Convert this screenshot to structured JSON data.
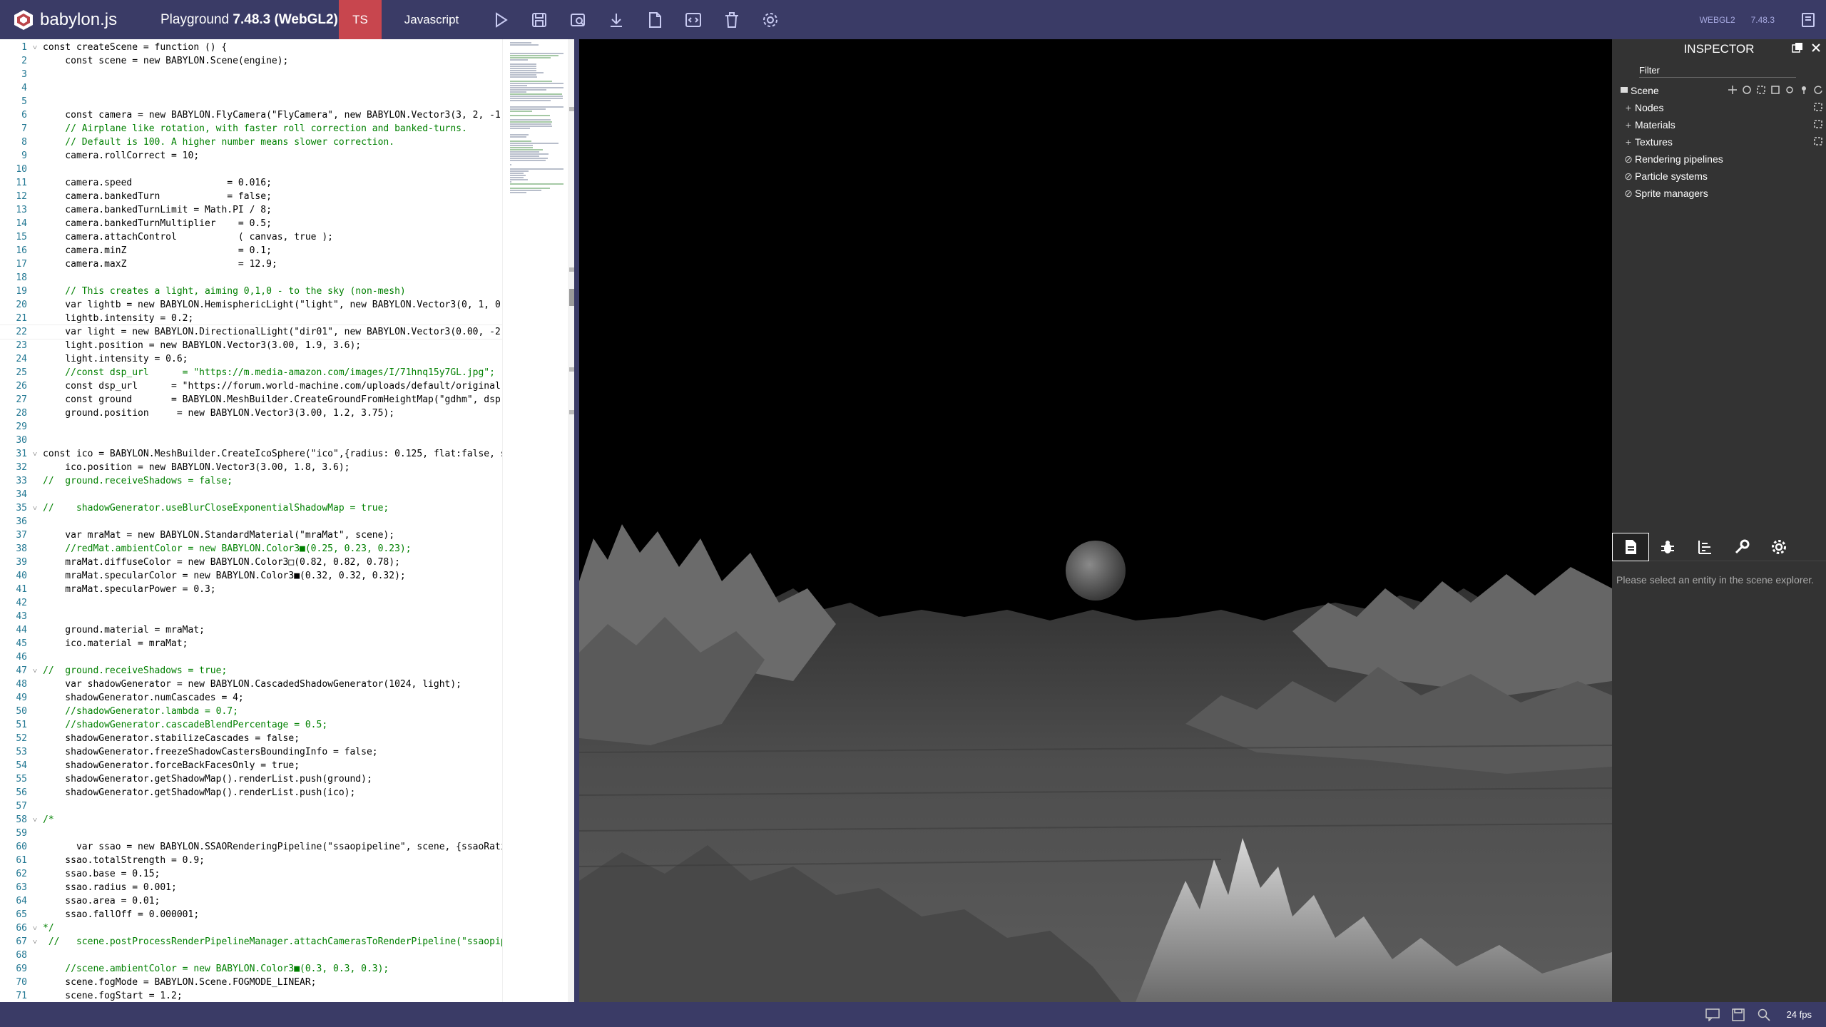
{
  "app": {
    "brand": "babylon.js",
    "title_prefix": "Playground ",
    "title_version": "7.48.3 (WebGL2)",
    "tabs": [
      "TS",
      "Javascript"
    ],
    "engine_label": "WEBGL2",
    "version_label": "7.48.3",
    "accent_color": "#3a3b66",
    "active_tab_color": "#c8464e"
  },
  "toolbar": {
    "icons": [
      "run-icon",
      "save-icon",
      "inspector-download-icon",
      "download-icon",
      "new-file-icon",
      "format-code-icon",
      "clear-icon",
      "settings-icon"
    ]
  },
  "editor": {
    "lines": [
      {
        "n": "1",
        "fold": "v",
        "t": "const createScene = function () {"
      },
      {
        "n": "2",
        "fold": "",
        "t": "    const scene = new BABYLON.Scene(engine);"
      },
      {
        "n": "3",
        "fold": "",
        "t": ""
      },
      {
        "n": "4",
        "fold": "",
        "t": ""
      },
      {
        "n": "5",
        "fold": "",
        "t": ""
      },
      {
        "n": "6",
        "fold": "",
        "t": "    const camera = new BABYLON.FlyCamera(\"FlyCamera\", new BABYLON.Vector3(3, 2, -1)"
      },
      {
        "n": "7",
        "fold": "",
        "t": "    // Airplane like rotation, with faster roll correction and banked-turns."
      },
      {
        "n": "8",
        "fold": "",
        "t": "    // Default is 100. A higher number means slower correction."
      },
      {
        "n": "9",
        "fold": "",
        "t": "    camera.rollCorrect = 10;"
      },
      {
        "n": "10",
        "fold": "",
        "t": ""
      },
      {
        "n": "11",
        "fold": "",
        "t": "    camera.speed                 = 0.016;"
      },
      {
        "n": "12",
        "fold": "",
        "t": "    camera.bankedTurn            = false;"
      },
      {
        "n": "13",
        "fold": "",
        "t": "    camera.bankedTurnLimit = Math.PI / 8;"
      },
      {
        "n": "14",
        "fold": "",
        "t": "    camera.bankedTurnMultiplier    = 0.5;"
      },
      {
        "n": "15",
        "fold": "",
        "t": "    camera.attachControl           ( canvas, true );"
      },
      {
        "n": "16",
        "fold": "",
        "t": "    camera.minZ                    = 0.1;"
      },
      {
        "n": "17",
        "fold": "",
        "t": "    camera.maxZ                    = 12.9;"
      },
      {
        "n": "18",
        "fold": "",
        "t": ""
      },
      {
        "n": "19",
        "fold": "",
        "t": "    // This creates a light, aiming 0,1,0 - to the sky (non-mesh)"
      },
      {
        "n": "20",
        "fold": "",
        "t": "    var lightb = new BABYLON.HemisphericLight(\"light\", new BABYLON.Vector3(0, 1, 0)"
      },
      {
        "n": "21",
        "fold": "",
        "t": "    lightb.intensity = 0.2;"
      },
      {
        "n": "22",
        "fold": "",
        "t": "    var light = new BABYLON.DirectionalLight(\"dir01\", new BABYLON.Vector3(0.00, -2."
      },
      {
        "n": "23",
        "fold": "",
        "t": "    light.position = new BABYLON.Vector3(3.00, 1.9, 3.6);"
      },
      {
        "n": "24",
        "fold": "",
        "t": "    light.intensity = 0.6;"
      },
      {
        "n": "25",
        "fold": "",
        "t": "    //const dsp_url      = \"https://m.media-amazon.com/images/I/71hnq15y7GL.jpg\";"
      },
      {
        "n": "26",
        "fold": "",
        "t": "    const dsp_url      = \"https://forum.world-machine.com/uploads/default/original"
      },
      {
        "n": "27",
        "fold": "",
        "t": "    const ground       = BABYLON.MeshBuilder.CreateGroundFromHeightMap(\"gdhm\", dsp"
      },
      {
        "n": "28",
        "fold": "",
        "t": "    ground.position     = new BABYLON.Vector3(3.00, 1.2, 3.75);"
      },
      {
        "n": "29",
        "fold": "",
        "t": ""
      },
      {
        "n": "30",
        "fold": "",
        "t": ""
      },
      {
        "n": "31",
        "fold": "v",
        "t": "const ico = BABYLON.MeshBuilder.CreateIcoSphere(\"ico\",{radius: 0.125, flat:false, s"
      },
      {
        "n": "32",
        "fold": "",
        "t": "    ico.position = new BABYLON.Vector3(3.00, 1.8, 3.6);"
      },
      {
        "n": "33",
        "fold": "",
        "t": "//  ground.receiveShadows = false;"
      },
      {
        "n": "34",
        "fold": "",
        "t": ""
      },
      {
        "n": "35",
        "fold": "v",
        "t": "//    shadowGenerator.useBlurCloseExponentialShadowMap = true;"
      },
      {
        "n": "36",
        "fold": "",
        "t": ""
      },
      {
        "n": "37",
        "fold": "",
        "t": "    var mraMat = new BABYLON.StandardMaterial(\"mraMat\", scene);"
      },
      {
        "n": "38",
        "fold": "",
        "t": "    //redMat.ambientColor = new BABYLON.Color3■(0.25, 0.23, 0.23);"
      },
      {
        "n": "39",
        "fold": "",
        "t": "    mraMat.diffuseColor = new BABYLON.Color3□(0.82, 0.82, 0.78);"
      },
      {
        "n": "40",
        "fold": "",
        "t": "    mraMat.specularColor = new BABYLON.Color3■(0.32, 0.32, 0.32);"
      },
      {
        "n": "41",
        "fold": "",
        "t": "    mraMat.specularPower = 0.3;"
      },
      {
        "n": "42",
        "fold": "",
        "t": ""
      },
      {
        "n": "43",
        "fold": "",
        "t": ""
      },
      {
        "n": "44",
        "fold": "",
        "t": "    ground.material = mraMat;"
      },
      {
        "n": "45",
        "fold": "",
        "t": "    ico.material = mraMat;"
      },
      {
        "n": "46",
        "fold": "",
        "t": ""
      },
      {
        "n": "47",
        "fold": "v",
        "t": "//  ground.receiveShadows = true;"
      },
      {
        "n": "48",
        "fold": "",
        "t": "    var shadowGenerator = new BABYLON.CascadedShadowGenerator(1024, light);"
      },
      {
        "n": "49",
        "fold": "",
        "t": "    shadowGenerator.numCascades = 4;"
      },
      {
        "n": "50",
        "fold": "",
        "t": "    //shadowGenerator.lambda = 0.7;"
      },
      {
        "n": "51",
        "fold": "",
        "t": "    //shadowGenerator.cascadeBlendPercentage = 0.5;"
      },
      {
        "n": "52",
        "fold": "",
        "t": "    shadowGenerator.stabilizeCascades = false;"
      },
      {
        "n": "53",
        "fold": "",
        "t": "    shadowGenerator.freezeShadowCastersBoundingInfo = false;"
      },
      {
        "n": "54",
        "fold": "",
        "t": "    shadowGenerator.forceBackFacesOnly = true;"
      },
      {
        "n": "55",
        "fold": "",
        "t": "    shadowGenerator.getShadowMap().renderList.push(ground);"
      },
      {
        "n": "56",
        "fold": "",
        "t": "    shadowGenerator.getShadowMap().renderList.push(ico);"
      },
      {
        "n": "57",
        "fold": "",
        "t": ""
      },
      {
        "n": "58",
        "fold": "v",
        "t": "/*"
      },
      {
        "n": "59",
        "fold": "",
        "t": ""
      },
      {
        "n": "60",
        "fold": "",
        "t": "      var ssao = new BABYLON.SSAORenderingPipeline(\"ssaopipeline\", scene, {ssaoRati"
      },
      {
        "n": "61",
        "fold": "",
        "t": "    ssao.totalStrength = 0.9;"
      },
      {
        "n": "62",
        "fold": "",
        "t": "    ssao.base = 0.15;"
      },
      {
        "n": "63",
        "fold": "",
        "t": "    ssao.radius = 0.001;"
      },
      {
        "n": "64",
        "fold": "",
        "t": "    ssao.area = 0.01;"
      },
      {
        "n": "65",
        "fold": "",
        "t": "    ssao.fallOff = 0.000001;"
      },
      {
        "n": "66",
        "fold": "v",
        "t": "*/"
      },
      {
        "n": "67",
        "fold": "v",
        "t": " //   scene.postProcessRenderPipelineManager.attachCamerasToRenderPipeline(\"ssaopip"
      },
      {
        "n": "68",
        "fold": "",
        "t": ""
      },
      {
        "n": "69",
        "fold": "",
        "t": "    //scene.ambientColor = new BABYLON.Color3■(0.3, 0.3, 0.3);"
      },
      {
        "n": "70",
        "fold": "",
        "t": "    scene.fogMode = BABYLON.Scene.FOGMODE_LINEAR;"
      },
      {
        "n": "71",
        "fold": "",
        "t": "    scene.fogStart = 1.2;"
      }
    ]
  },
  "inspector": {
    "title": "INSPECTOR",
    "filter_placeholder": "Filter",
    "scene_label": "Scene",
    "items": [
      {
        "label": "Nodes",
        "icon": "plus-icon",
        "expandable": true
      },
      {
        "label": "Materials",
        "icon": "plus-icon",
        "expandable": true
      },
      {
        "label": "Textures",
        "icon": "plus-icon",
        "expandable": true
      },
      {
        "label": "Rendering pipelines",
        "icon": "ban-icon",
        "expandable": false
      },
      {
        "label": "Particle systems",
        "icon": "ban-icon",
        "expandable": false
      },
      {
        "label": "Sprite managers",
        "icon": "ban-icon",
        "expandable": false
      }
    ],
    "tabs": [
      "properties-icon",
      "debug-icon",
      "statistics-icon",
      "tools-icon",
      "settings-icon"
    ],
    "empty_message": "Please select an entity in the scene explorer."
  },
  "status": {
    "fps": "24 fps"
  }
}
